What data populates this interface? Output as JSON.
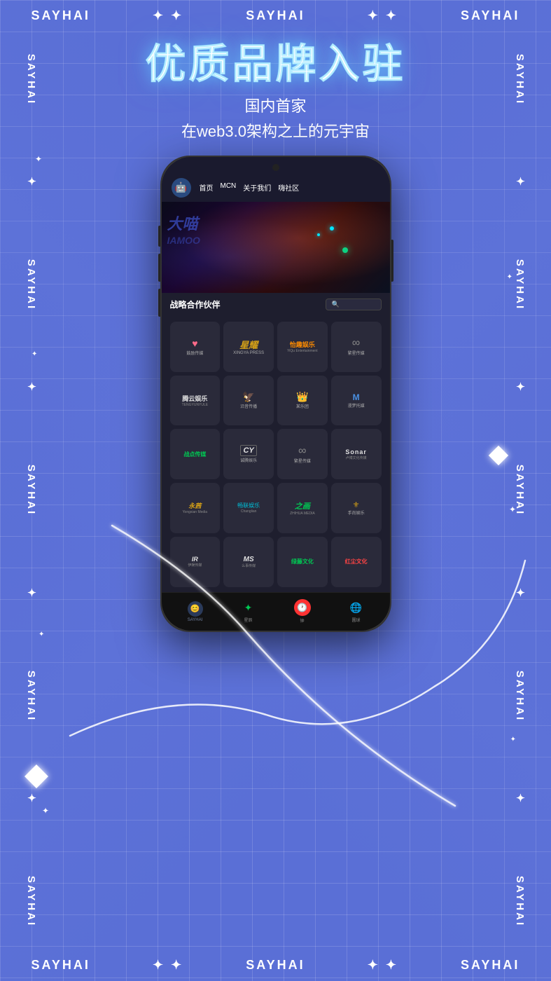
{
  "brand": "SAYHAI",
  "header": {
    "title": "优质品牌入驻",
    "subtitle1": "国内首家",
    "subtitle2": "在web3.0架构之上的元宇宙"
  },
  "phone": {
    "nav": {
      "logo": "🤖",
      "links": [
        "首页",
        "MCN",
        "关于我们",
        "嗨社区"
      ]
    },
    "partner_section": {
      "title": "战略合作伙伴",
      "search_placeholder": "🔍"
    },
    "brands": [
      {
        "name": "鼓励传媒",
        "icon": "♥",
        "color": "#2a2a3a"
      },
      {
        "name": "星耀传媒",
        "icon": "YL",
        "color": "#2a2a3a"
      },
      {
        "name": "怡趣娱乐",
        "icon": "怡趣",
        "color": "#2a2a3a"
      },
      {
        "name": "繁星传媒",
        "icon": "∞",
        "color": "#2a2a3a"
      },
      {
        "name": "腾云娱乐",
        "icon": "腾云",
        "color": "#2a2a3a"
      },
      {
        "name": "沿音传播",
        "icon": "沿音",
        "color": "#2a2a3a"
      },
      {
        "name": "某乐团",
        "icon": "🎵",
        "color": "#2a2a3a"
      },
      {
        "name": "漫梦托媒",
        "icon": "M",
        "color": "#2a2a3a"
      },
      {
        "name": "战点传媒",
        "icon": "战点",
        "color": "#2a2a3a"
      },
      {
        "name": "CY娱乐",
        "icon": "CY",
        "color": "#2a2a3a"
      },
      {
        "name": "繁星传媒2",
        "icon": "∞",
        "color": "#2a2a3a"
      },
      {
        "name": "Sonar",
        "icon": "Sonar",
        "color": "#2a2a3a"
      },
      {
        "name": "永茜传媒",
        "icon": "永茜",
        "color": "#2a2a3a"
      },
      {
        "name": "畅联娱乐",
        "icon": "畅联",
        "color": "#2a2a3a"
      },
      {
        "name": "之画传媒",
        "icon": "之画",
        "color": "#2a2a3a"
      },
      {
        "name": "手尚娱乐",
        "icon": "手尚",
        "color": "#2a2a3a"
      },
      {
        "name": "IR娱乐",
        "icon": "IR",
        "color": "#2a2a3a"
      },
      {
        "name": "MS传媒",
        "icon": "MS",
        "color": "#2a2a3a"
      },
      {
        "name": "绿藤文化",
        "icon": "绿藤",
        "color": "#2a2a3a"
      },
      {
        "name": "红尘文化",
        "icon": "红尘",
        "color": "#2a2a3a"
      }
    ],
    "bottom_nav": [
      {
        "label": "SAYHAI",
        "icon": "😊"
      },
      {
        "label": "星辰",
        "icon": "⭐"
      },
      {
        "label": "钟",
        "icon": "🕐"
      },
      {
        "label": "圆球",
        "icon": "🔵"
      }
    ]
  },
  "decorations": {
    "corner_stars": [
      "✦",
      "✦",
      "✦",
      "✦"
    ],
    "diamonds": 4
  }
}
